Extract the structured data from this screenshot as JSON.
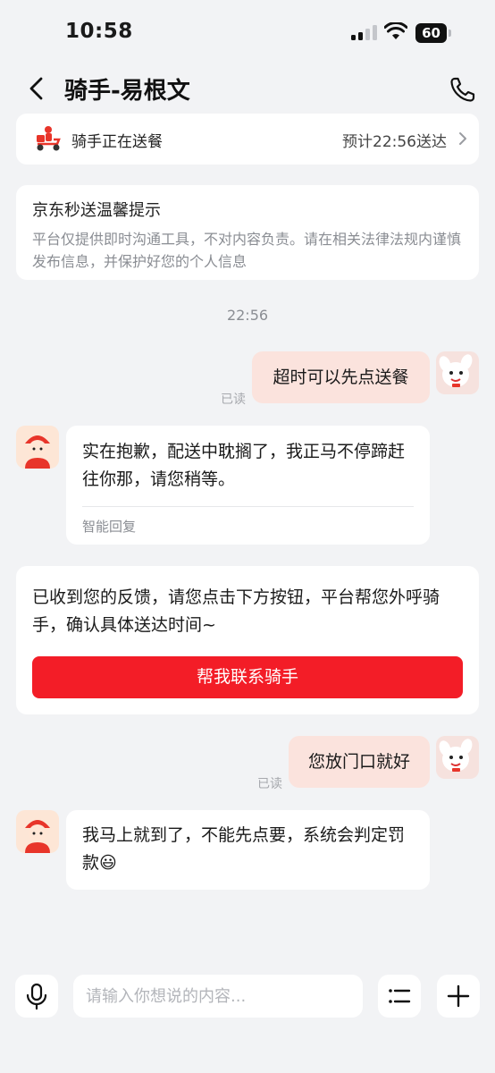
{
  "status_bar": {
    "time": "10:58",
    "battery": "60"
  },
  "header": {
    "title": "骑手-易根文"
  },
  "delivery": {
    "status": "骑手正在送餐",
    "eta": "预计22:56送达"
  },
  "notice": {
    "title": "京东秒送温馨提示",
    "body": "平台仅提供即时沟通工具，不对内容负责。请在相关法律法规内谨慎发布信息，并保护好您的个人信息"
  },
  "chat": {
    "timestamp": "22:56",
    "messages": [
      {
        "direction": "out",
        "text": "超时可以先点送餐",
        "read": "已读"
      },
      {
        "direction": "in",
        "text": "实在抱歉，配送中耽搁了，我正马不停蹄赶往你那，请您稍等。",
        "tag": "智能回复"
      },
      {
        "direction": "out",
        "text": "您放门口就好",
        "read": "已读"
      },
      {
        "direction": "in",
        "text": "我马上就到了，不能先点要，系统会判定罚款😃"
      }
    ],
    "feedback": {
      "text": "已收到您的反馈，请您点击下方按钮，平台帮您外呼骑手，确认具体送达时间~",
      "button_label": "帮我联系骑手"
    }
  },
  "input_bar": {
    "placeholder": "请输入你想说的内容..."
  },
  "colors": {
    "accent": "#f31d27",
    "outgoing_bubble": "#fbe3dd",
    "background": "#f2f3f5"
  }
}
